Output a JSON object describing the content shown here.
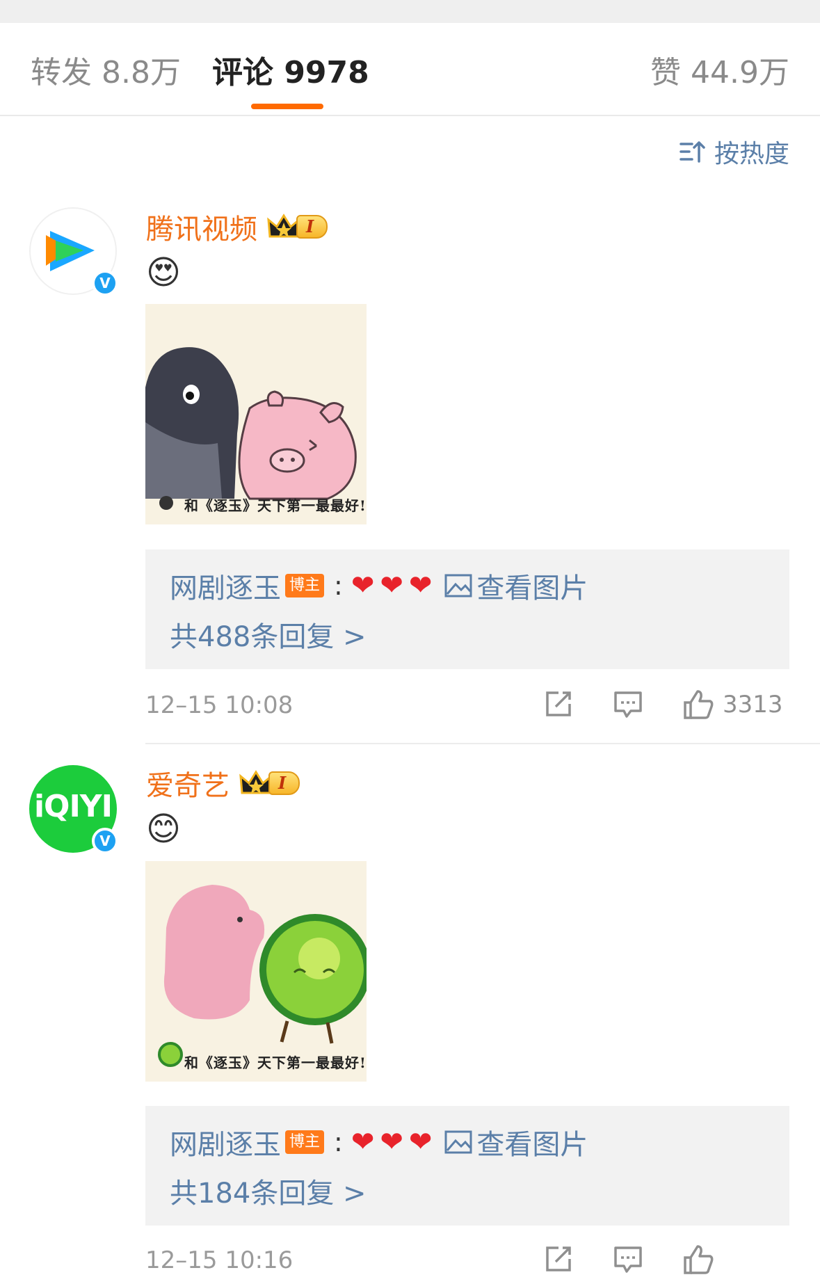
{
  "tabs": {
    "repost": "转发 8.8万",
    "comments": "评论 9978",
    "likes": "赞 44.9万"
  },
  "sort": {
    "label": "按热度",
    "icon": "sort-icon"
  },
  "comments": [
    {
      "username": "腾讯视频",
      "avatar": "tencent-video-logo",
      "verified": "V",
      "crown_level": "I",
      "emoji": "😍",
      "image_caption": "和《逐玉》天下第一最最好!",
      "reply": {
        "name": "网剧逐玉",
        "tag": "博主",
        "hearts": "❤❤❤",
        "view_picture": "查看图片",
        "total": "共488条回复 >"
      },
      "time": "12–15 10:08",
      "likes": "3313"
    },
    {
      "username": "爱奇艺",
      "avatar": "iqiyi-logo",
      "avatar_text": "iQIYI",
      "verified": "V",
      "crown_level": "I",
      "emoji": "😊",
      "image_caption": "和《逐玉》天下第一最最好!",
      "reply": {
        "name": "网剧逐玉",
        "tag": "博主",
        "hearts": "❤❤❤",
        "view_picture": "查看图片",
        "total": "共184条回复 >"
      },
      "time": "12–15 10:16",
      "likes": ""
    }
  ],
  "colors": {
    "accent": "#ff6a00",
    "link": "#5b7fa8",
    "username": "#f0711a",
    "heart": "#e8232b"
  }
}
